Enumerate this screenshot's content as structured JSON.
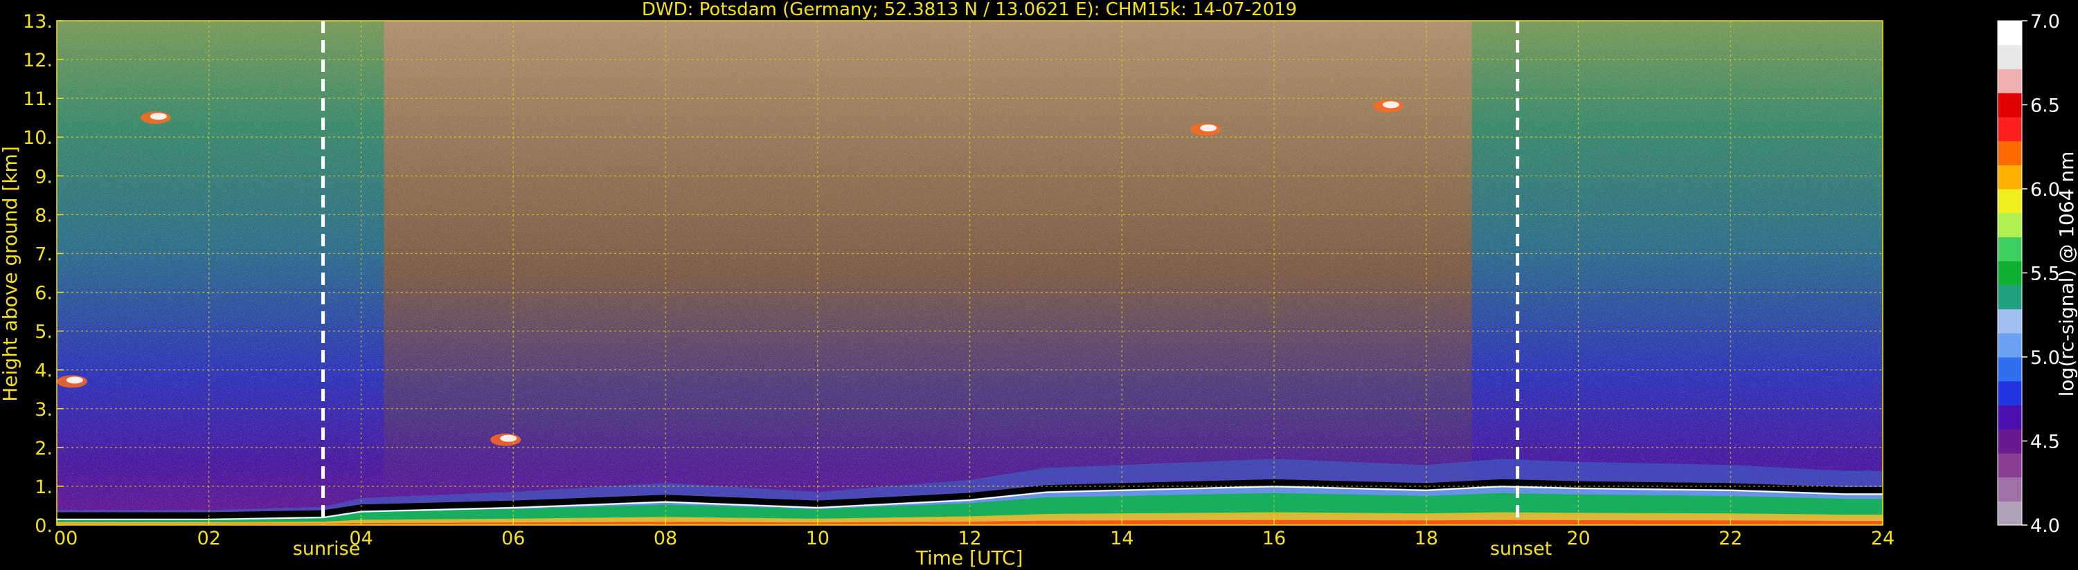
{
  "chart_data": {
    "type": "heatmap",
    "title": "DWD: Potsdam (Germany; 52.3813 N / 13.0621 E):    CHM15k: 14-07-2019",
    "xlabel": "Time [UTC]",
    "ylabel": "Height above ground [km]",
    "colorbar_label": "log(rc-signal) @ 1064 nm",
    "xlim": [
      0,
      24
    ],
    "ylim": [
      0,
      13
    ],
    "x_ticks": [
      "00",
      "02",
      "04",
      "06",
      "08",
      "10",
      "12",
      "14",
      "16",
      "18",
      "20",
      "22",
      "24"
    ],
    "y_ticks": [
      "0.",
      "1.",
      "2.",
      "3.",
      "4.",
      "5.",
      "6.",
      "7.",
      "8.",
      "9.",
      "10.",
      "11.",
      "12.",
      "13."
    ],
    "colorbar_range": [
      4.0,
      7.0
    ],
    "colorbar_ticks": [
      "4.0",
      "4.5",
      "5.0",
      "5.5",
      "6.0",
      "6.5",
      "7.0"
    ],
    "grid": true,
    "annotations": [
      {
        "label": "sunrise",
        "x": 3.5
      },
      {
        "label": "sunset",
        "x": 19.2
      }
    ],
    "boundary_layer_top_km": [
      [
        0,
        0.25
      ],
      [
        2,
        0.25
      ],
      [
        3.5,
        0.3
      ],
      [
        4,
        0.45
      ],
      [
        6,
        0.55
      ],
      [
        8,
        0.7
      ],
      [
        10,
        0.55
      ],
      [
        12,
        0.75
      ],
      [
        13,
        0.95
      ],
      [
        14,
        1.0
      ],
      [
        16,
        1.1
      ],
      [
        18,
        1.0
      ],
      [
        19,
        1.1
      ],
      [
        20,
        1.05
      ],
      [
        22,
        1.0
      ],
      [
        23.5,
        0.9
      ],
      [
        24,
        0.9
      ]
    ],
    "cloud_patches": [
      {
        "x": 1.3,
        "height_km": 10.5
      },
      {
        "x": 15.1,
        "height_km": 10.2
      },
      {
        "x": 17.5,
        "height_km": 10.8
      },
      {
        "x": 5.9,
        "height_km": 2.2
      },
      {
        "x": 0.2,
        "height_km": 3.7
      }
    ],
    "colors": {
      "text": "#f5e11a",
      "grid": "#e6d21a",
      "background": "#000000",
      "colormap": [
        "#b0a0b8",
        "#a070a8",
        "#8a3f95",
        "#6a1a90",
        "#4a10b0",
        "#2035e0",
        "#3070f0",
        "#6aa0f0",
        "#a0c0f0",
        "#20a080",
        "#10b030",
        "#40d060",
        "#b0f050",
        "#f0f020",
        "#ffb000",
        "#ff6a00",
        "#ff2020",
        "#e00000",
        "#f0b0b0",
        "#e8e8e8",
        "#ffffff"
      ]
    }
  }
}
